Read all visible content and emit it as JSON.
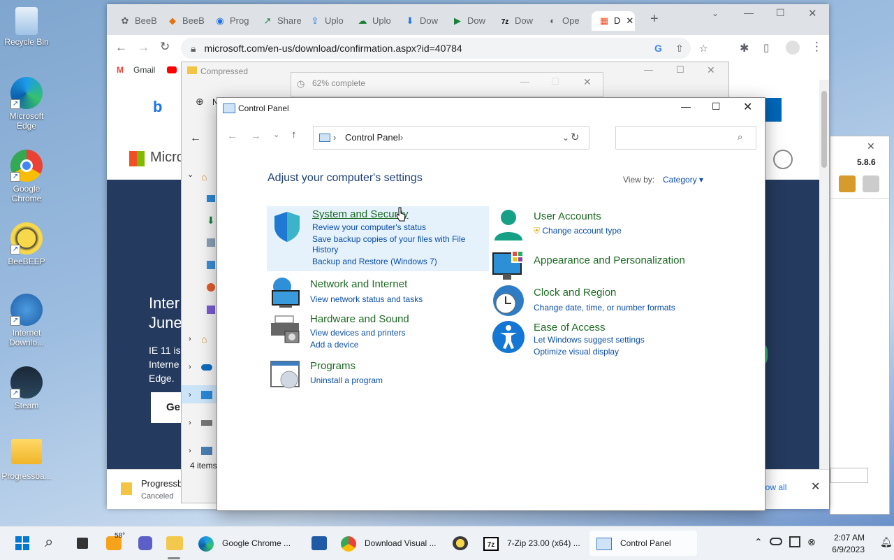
{
  "desktop": {
    "icons": [
      {
        "label": "Recycle Bin"
      },
      {
        "label": "Microsoft Edge"
      },
      {
        "label": "Google Chrome"
      },
      {
        "label": "BeeBEEP"
      },
      {
        "label": "Internet Downlo..."
      },
      {
        "label": "Steam"
      },
      {
        "label": "Progressba..."
      }
    ]
  },
  "chrome": {
    "tabs": [
      "BeeB",
      "BeeB",
      "Prog",
      "Share",
      "Uplo",
      "Uplo",
      "Dow",
      "Dow",
      "Dow",
      "Ope",
      "D"
    ],
    "url": "microsoft.com/en-us/download/confirmation.aspx?id=40784",
    "bookmarks": [
      "Gmail"
    ],
    "page": {
      "brand": "Micro",
      "headline1": "Inter",
      "headline2": "June",
      "body1": "IE 11 is",
      "body2": "Interne",
      "body3": "Edge.",
      "button": "Ge"
    },
    "download": {
      "filename": "Progressbar95.v20",
      "status": "Canceled",
      "show_all": "how all"
    }
  },
  "explorer": {
    "title": "Compressed",
    "new_label": "N",
    "items_count": "4 items"
  },
  "progress": {
    "title": "62% complete"
  },
  "right_app": {
    "version": "5.8.6"
  },
  "control_panel": {
    "title": "Control Panel",
    "breadcrumb": "Control Panel",
    "heading": "Adjust your computer's settings",
    "view_by_label": "View by:",
    "view_by_value": "Category",
    "categories": [
      {
        "title": "System and Security",
        "links": [
          "Review your computer's status",
          "Save backup copies of your files with File",
          "History",
          "Backup and Restore (Windows 7)"
        ]
      },
      {
        "title": "Network and Internet",
        "links": [
          "View network status and tasks"
        ]
      },
      {
        "title": "Hardware and Sound",
        "links": [
          "View devices and printers",
          "Add a device"
        ]
      },
      {
        "title": "Programs",
        "links": [
          "Uninstall a program"
        ]
      },
      {
        "title": "User Accounts",
        "links": [
          "Change account type"
        ]
      },
      {
        "title": "Appearance and Personalization",
        "links": []
      },
      {
        "title": "Clock and Region",
        "links": [
          "Change date, time, or number formats"
        ]
      },
      {
        "title": "Ease of Access",
        "links": [
          "Let Windows suggest settings",
          "Optimize visual display"
        ]
      }
    ]
  },
  "taskbar": {
    "weather": "58°",
    "items": [
      "Google Chrome ...",
      "Download Visual ...",
      "7-Zip 23.00 (x64) ...",
      "Control Panel"
    ],
    "time": "2:07 AM",
    "date": "6/9/2023"
  },
  "colors": {
    "accent": "#0a4fa8",
    "category_green": "#1e6c24",
    "highlight": "#e5f1fb"
  }
}
